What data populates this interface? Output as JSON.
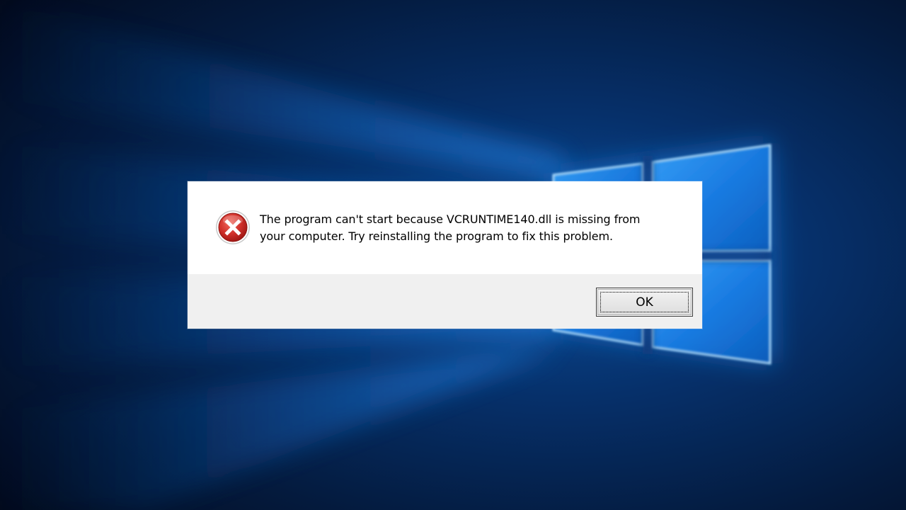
{
  "dialog": {
    "icon": "error-icon",
    "message_lines": [
      "The program can't start because VCRUNTIME140.dll is missing from",
      "your computer. Try reinstalling the program to fix this problem."
    ],
    "ok_label": "OK"
  },
  "colors": {
    "error_red": "#d0302a",
    "content_bg": "#ffffff",
    "button_bar_bg": "#f0f0f0",
    "wallpaper_blue": "#1a8cff"
  }
}
